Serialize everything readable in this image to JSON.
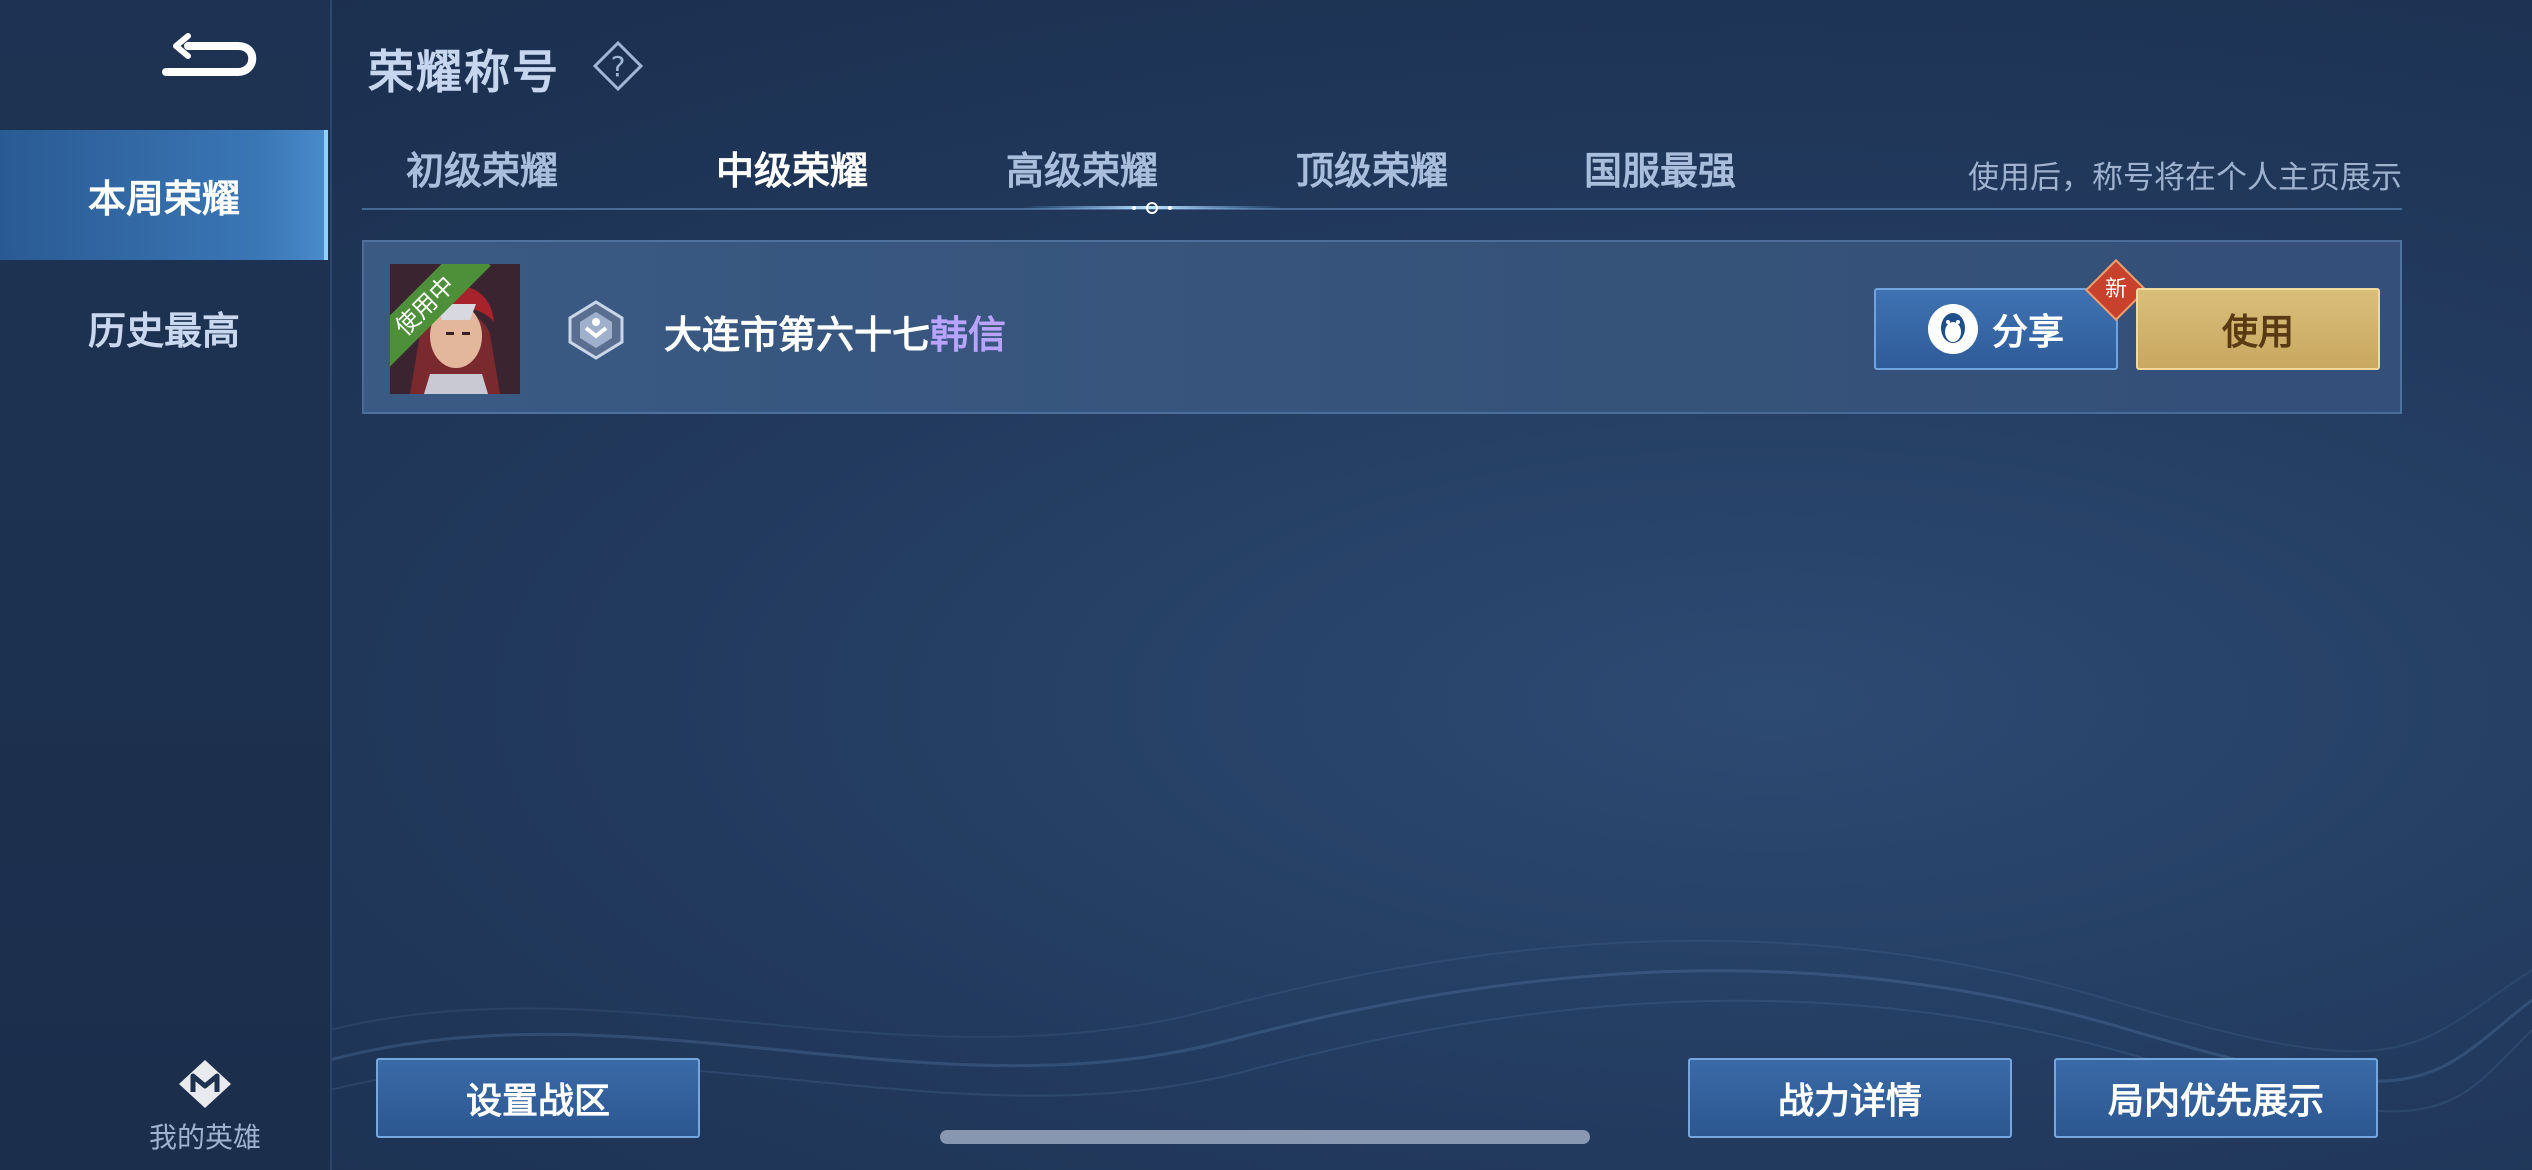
{
  "header": {
    "title": "荣耀称号",
    "help_icon": "question-icon"
  },
  "sidebar": {
    "back_icon": "back-arrow-icon",
    "items": [
      {
        "label": "本周荣耀",
        "active": true
      },
      {
        "label": "历史最高",
        "active": false
      }
    ],
    "my_hero": {
      "label": "我的英雄",
      "icon": "hero-emblem-icon"
    }
  },
  "tabs": [
    {
      "label": "初级荣耀",
      "active": false
    },
    {
      "label": "中级荣耀",
      "active": true
    },
    {
      "label": "高级荣耀",
      "active": false
    },
    {
      "label": "顶级荣耀",
      "active": false
    },
    {
      "label": "国服最强",
      "active": false
    }
  ],
  "hint": "使用后，称号将在个人主页展示",
  "titles_list": [
    {
      "status_ribbon": "使用中",
      "rank_icon": "silver-rank-icon",
      "title_prefix": "大连市第六十七",
      "hero_name": "韩信",
      "share_label": "分享",
      "share_icon": "qq-penguin-icon",
      "new_badge": "新",
      "use_label": "使用"
    }
  ],
  "bottom": {
    "set_zone_label": "设置战区",
    "power_details_label": "战力详情",
    "priority_display_label": "局内优先展示"
  },
  "colors": {
    "accent_gold": "#d9be7a",
    "accent_blue": "#3a6aa7",
    "hero_name_color": "#b8a3ff",
    "ribbon_green": "#4e8f3a",
    "badge_red": "#c8412d"
  }
}
